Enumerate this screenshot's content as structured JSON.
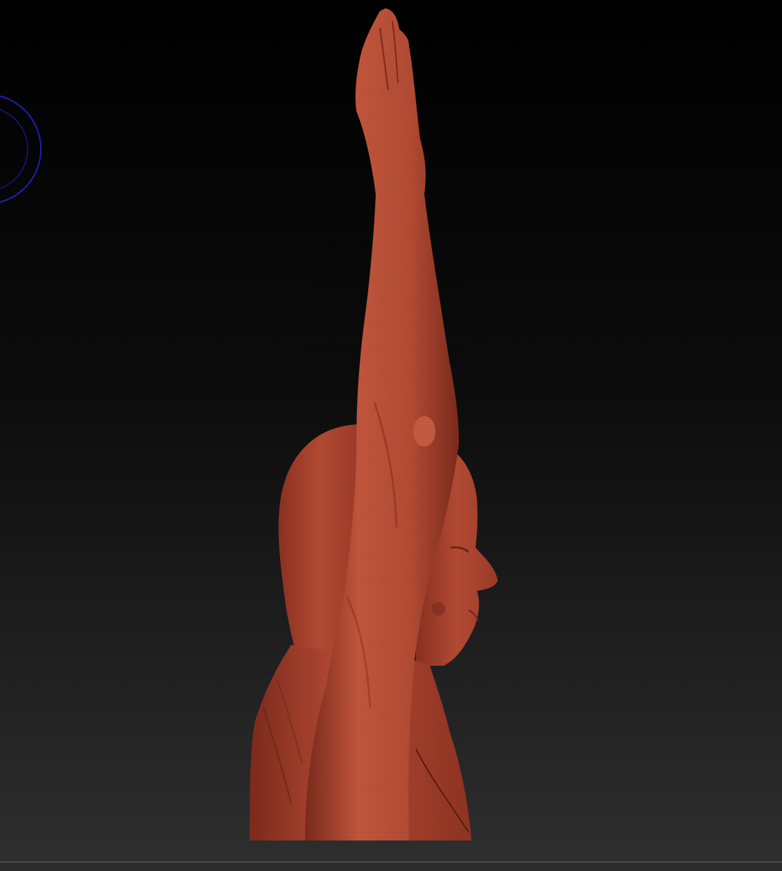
{
  "app": {
    "viewport_label": "",
    "model_name": ""
  },
  "colors": {
    "bg_top": "#000000",
    "bg_bottom": "#303030",
    "model_base": "#b44a34",
    "model_light": "#c85a42",
    "model_shadow": "#6e2418",
    "gizmo_ring": "#1f1fb8",
    "status_bar": "#2c2c2c"
  },
  "icons": {
    "transform_gizmo": "rotation-ring-icon"
  }
}
